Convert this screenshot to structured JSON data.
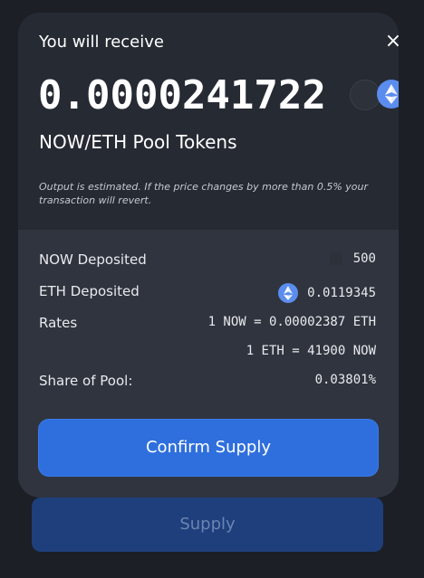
{
  "modal": {
    "heading": "You will receive",
    "close_label": "×",
    "amount": "0.0000241722",
    "pool_name": "NOW/ETH Pool Tokens",
    "note": "Output is estimated. If the price changes by more than 0.5% your transaction will revert."
  },
  "details": {
    "now_deposited_label": "NOW Deposited",
    "now_deposited_value": "500",
    "eth_deposited_label": "ETH Deposited",
    "eth_deposited_value": "0.0119345",
    "rates_label": "Rates",
    "rate_now_eth": "1 NOW = 0.00002387 ETH",
    "rate_eth_now": "1 ETH = 41900 NOW",
    "share_label": "Share of Pool:",
    "share_value": "0.03801%"
  },
  "buttons": {
    "confirm_label": "Confirm Supply",
    "supply_label": "Supply"
  },
  "icons": {
    "close": "close-icon",
    "now_token": "now-token-icon",
    "eth_token": "eth-token-icon"
  },
  "colors": {
    "background": "#1c1f26",
    "modal": "#262a33",
    "details_panel": "#30343e",
    "accent": "#2f6fdd",
    "disabled": "#1e3f7c"
  }
}
